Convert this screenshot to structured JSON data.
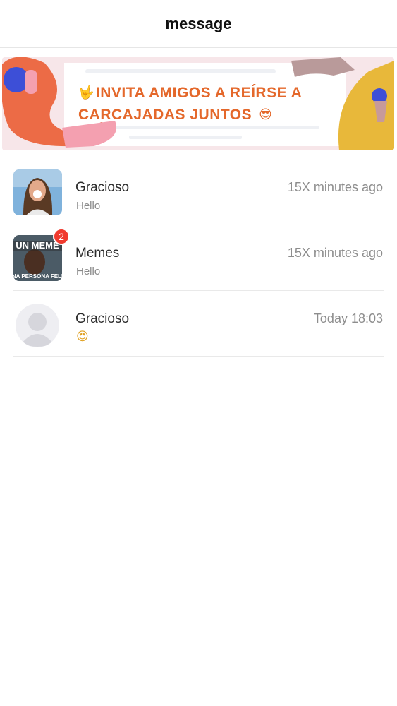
{
  "header": {
    "title": "message"
  },
  "banner": {
    "line1_emoji": "🤟",
    "line1": "INVITA AMIGOS A REÍRSE A",
    "line2": "CARCAJADAS JUNTOS",
    "line2_emoji": "😎"
  },
  "conversations": [
    {
      "name": "Gracioso",
      "preview": "Hello",
      "time": "15X minutes ago",
      "badge": ""
    },
    {
      "name": "Memes",
      "preview": "Hello",
      "time": "15X minutes ago",
      "badge": "2",
      "avatar_text_top": "UN MEME",
      "avatar_text_bottom": "NA PERSONA FELI"
    },
    {
      "name": "Gracioso",
      "preview": "😍",
      "time": "Today  18:03",
      "badge": ""
    }
  ]
}
